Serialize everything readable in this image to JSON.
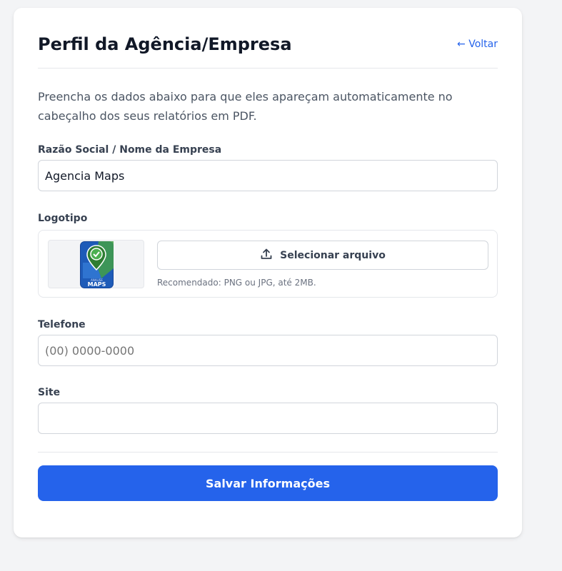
{
  "header": {
    "title": "Perfil da Agência/Empresa",
    "back_label": "← Voltar"
  },
  "intro_text": "Preencha os dados abaixo para que eles apareçam automaticamente no cabeçalho dos seus relatórios em PDF.",
  "fields": {
    "company": {
      "label": "Razão Social / Nome da Empresa",
      "value": "Agencia Maps"
    },
    "logo": {
      "label": "Logotipo",
      "button_label": "Selecionar arquivo",
      "hint": "Recomendado: PNG ou JPG, até 2MB.",
      "logo_text": "MAPS",
      "logo_small_text": "ANALISE"
    },
    "phone": {
      "label": "Telefone",
      "placeholder": "(00) 0000-0000",
      "value": ""
    },
    "site": {
      "label": "Site",
      "placeholder": "",
      "value": ""
    }
  },
  "actions": {
    "save_label": "Salvar Informações"
  },
  "colors": {
    "primary": "#2563eb",
    "background": "#f3f4f6",
    "logo_blue": "#1e5bb8",
    "logo_green": "#4caf50"
  }
}
